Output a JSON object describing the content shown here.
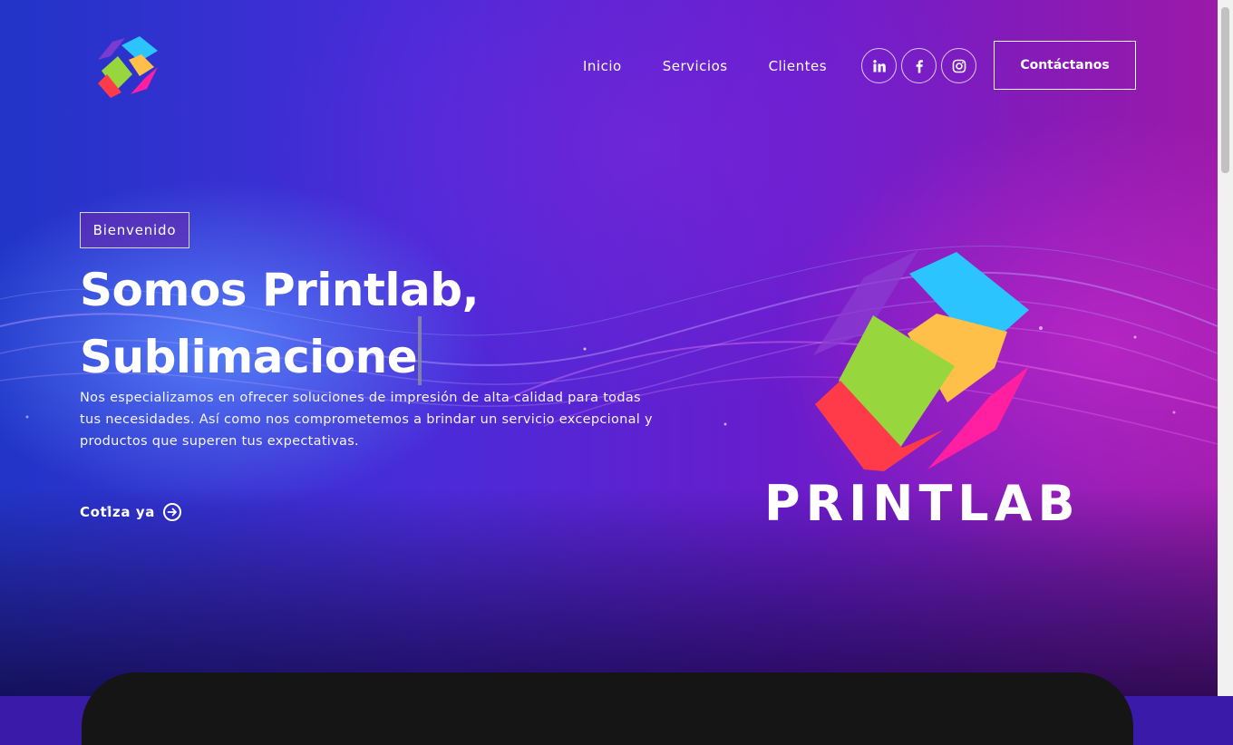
{
  "nav": {
    "items": [
      {
        "label": "Inicio"
      },
      {
        "label": "Servicios"
      },
      {
        "label": "Clientes"
      }
    ],
    "socials": [
      {
        "icon": "linkedin-icon"
      },
      {
        "icon": "facebook-icon"
      },
      {
        "icon": "instagram-icon"
      }
    ],
    "contact_label": "Contáctanos"
  },
  "hero": {
    "badge": "Bienvenido",
    "headline_line1": "Somos Printlab,",
    "headline_line2": "Sublimacione",
    "description": "Nos especializamos en ofrecer soluciones de impresión de alta calidad para todas tus necesidades. Así como nos comprometemos a brindar un servicio excepcional y productos que superen tus expectativas.",
    "cta_label": "Cotiza ya"
  },
  "brand": {
    "word": "PRINTLAB",
    "colors": {
      "cyan": "#2bc4ff",
      "yellow": "#ffc04a",
      "green": "#98d63e",
      "red": "#ff3b4a",
      "magenta": "#ff1fa0",
      "purple": "#8a3cd0"
    }
  }
}
